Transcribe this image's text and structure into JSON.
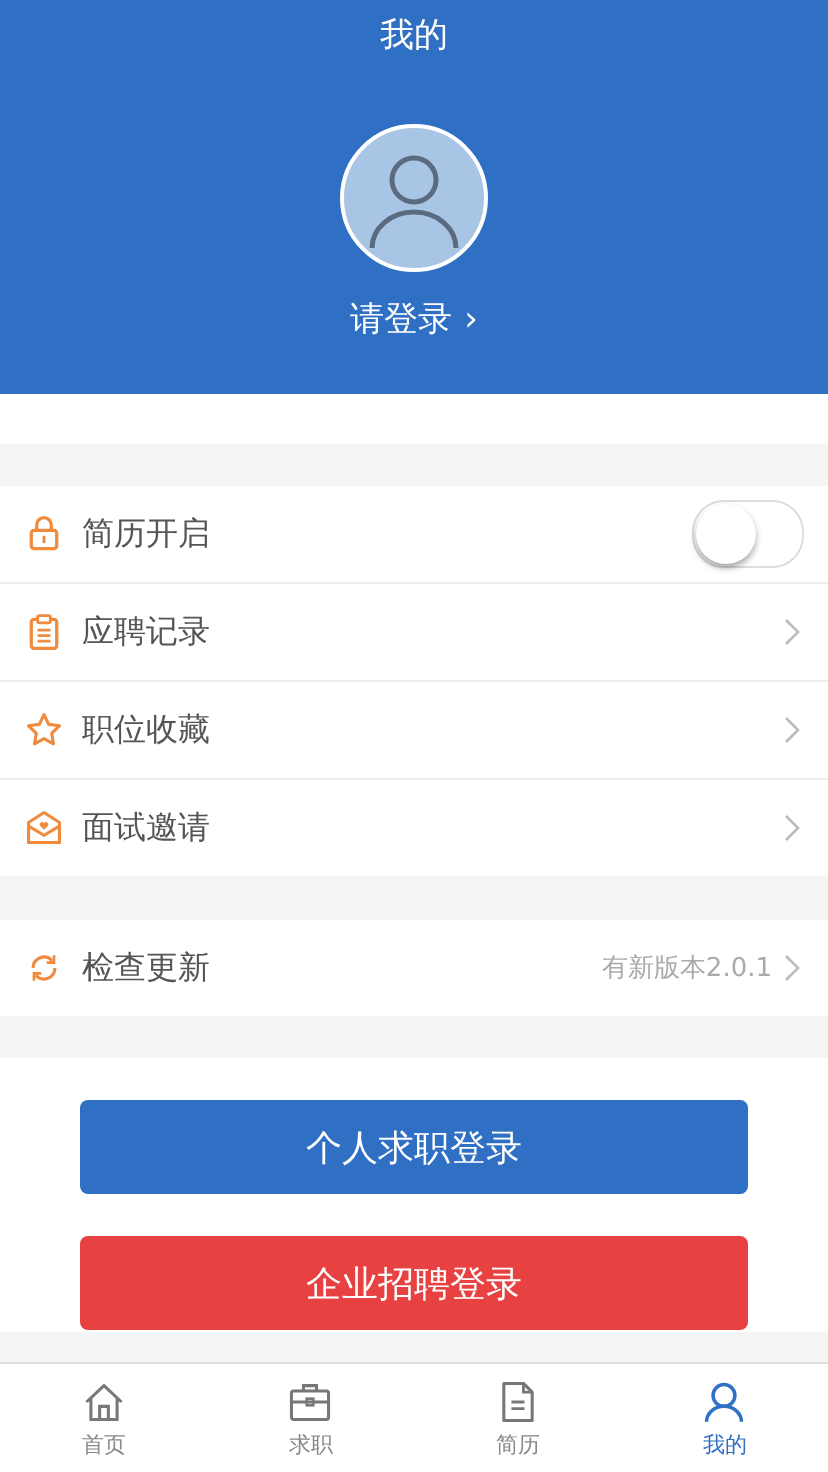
{
  "header": {
    "title": "我的",
    "login_link": "请登录",
    "login_chevron": "›"
  },
  "menu_groups": [
    {
      "items": [
        {
          "kind": "toggle",
          "label": "简历开启",
          "on": false
        },
        {
          "kind": "link",
          "label": "应聘记录"
        },
        {
          "kind": "link",
          "label": "职位收藏"
        },
        {
          "kind": "link",
          "label": "面试邀请"
        }
      ]
    },
    {
      "items": [
        {
          "kind": "link",
          "label": "检查更新",
          "detail": "有新版本2.0.1"
        }
      ]
    }
  ],
  "buttons": [
    {
      "label": "个人求职登录",
      "color": "#2f6fc4"
    },
    {
      "label": "企业招聘登录",
      "color": "#e84141"
    }
  ],
  "tabs": [
    {
      "label": "首页",
      "selected": false
    },
    {
      "label": "求职",
      "selected": false
    },
    {
      "label": "简历",
      "selected": false
    },
    {
      "label": "我的",
      "selected": true
    }
  ]
}
